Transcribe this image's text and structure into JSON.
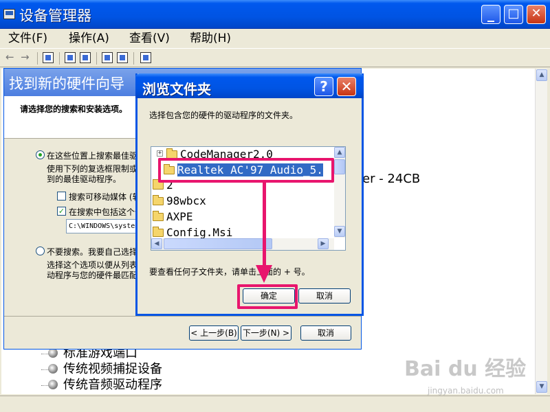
{
  "window": {
    "title": "设备管理器",
    "controls": {
      "minimize": "_",
      "maximize": "□",
      "close": "✕"
    }
  },
  "menu": {
    "file": "文件(F)",
    "action": "操作(A)",
    "view": "查看(V)",
    "help": "帮助(H)"
  },
  "toolbar": {
    "back": "←",
    "forward": "→"
  },
  "content": {
    "behind_text": "er - 24CB",
    "tree_items": [
      "标准游戏端口",
      "传统视频捕捉设备",
      "传统音频驱动程序"
    ]
  },
  "wizard": {
    "title": "找到新的硬件向导",
    "header": "请选择您的搜索和安装选项。",
    "option_search": "在这些位置上搜索最佳驱",
    "option_search_desc1": "使用下列的复选框限制或",
    "option_search_desc2": "到的最佳驱动程序。",
    "check_removable": "搜索可移动媒体 (软",
    "check_include": "在搜索中包括这个位",
    "path_value": "C:\\WINDOWS\\system",
    "option_manual": "不要搜索。我要自己选择",
    "option_manual_desc1": "选择这个选项以便从列表",
    "option_manual_desc2": "动程序与您的硬件最匹配",
    "back_button": "< 上一步(B)",
    "next_button": "下一步(N) >",
    "cancel_button": "取消"
  },
  "dialog": {
    "title": "浏览文件夹",
    "help": "?",
    "close": "✕",
    "instruction": "选择包含您的硬件的驱动程序的文件夹。",
    "folders": [
      {
        "name": "CodeManager2.0",
        "expander": "+"
      },
      {
        "name": "Realtek AC'97 Audio_5.",
        "selected": true
      },
      {
        "name": "2"
      },
      {
        "name": "98wbcx"
      },
      {
        "name": "AXPE"
      },
      {
        "name": "Config.Msi"
      }
    ],
    "hint": "要查看任何子文件夹，请单击上面的 + 号。",
    "ok_button": "确定",
    "cancel_button": "取消"
  },
  "watermark": {
    "brand": "Bai du 经验",
    "url": "jingyan.baidu.com"
  },
  "colors": {
    "xp_blue": "#0054e3",
    "highlight": "#e8156d",
    "selection": "#316ac5"
  }
}
